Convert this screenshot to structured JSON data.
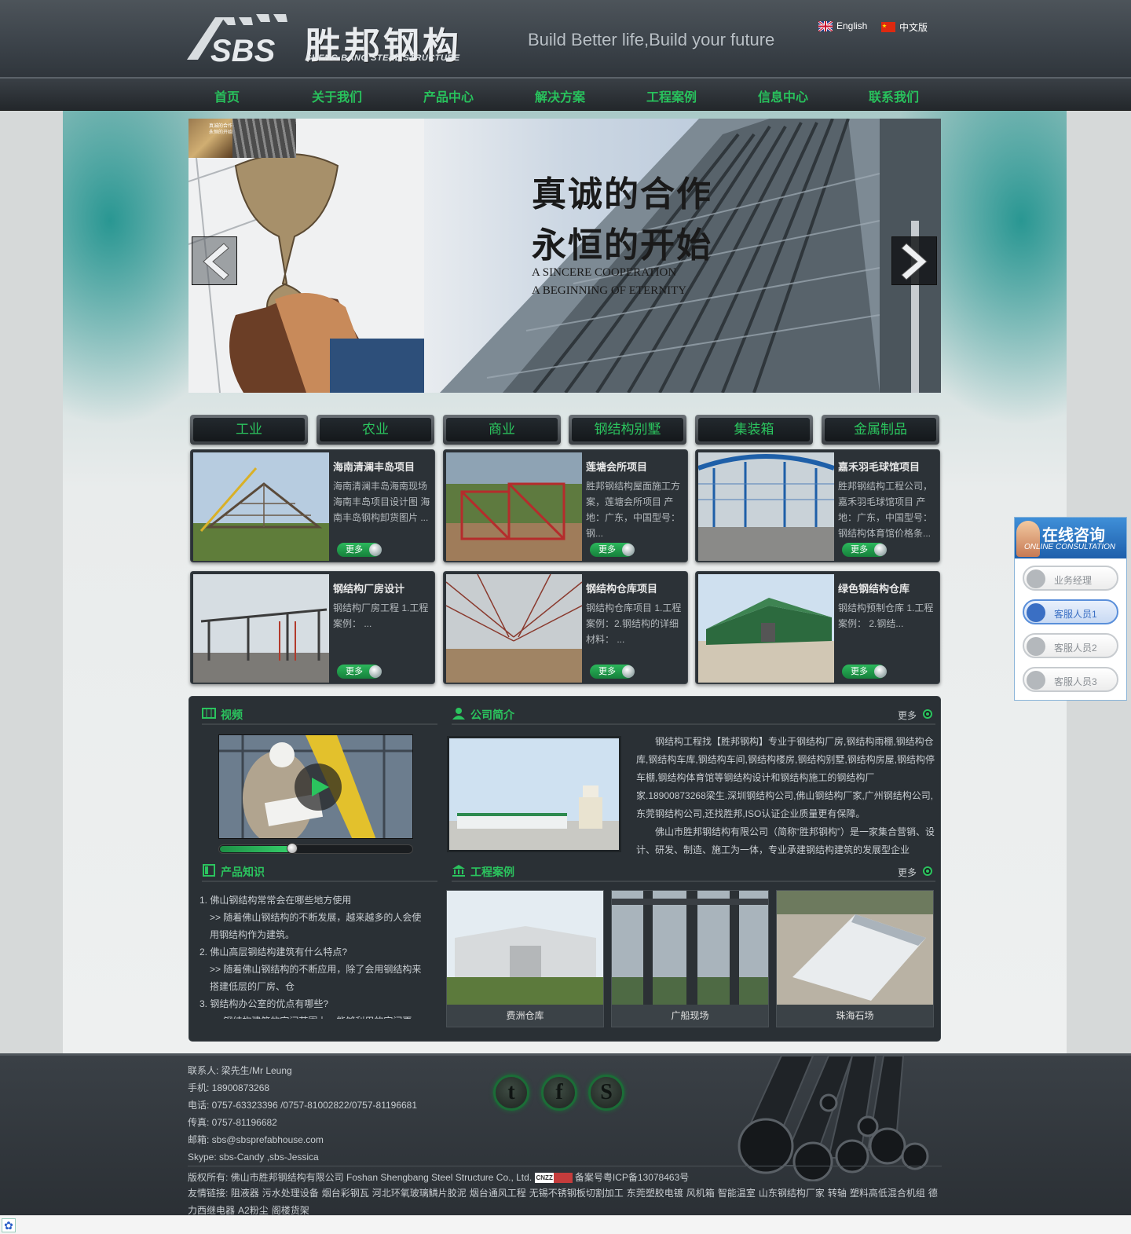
{
  "header": {
    "logo_cn": "胜邦钢构",
    "logo_en": "SHENG BANG STEEL STRUCTURE",
    "logo_mark": "SBS",
    "slogan": "Build Better life,Build your future",
    "lang_en": "English",
    "lang_cn": "中文版"
  },
  "nav": [
    "首页",
    "关于我们",
    "产品中心",
    "解决方案",
    "工程案例",
    "信息中心",
    "联系我们"
  ],
  "banner": {
    "title_line1": "真诚的合作",
    "title_line2": "永恒的开始",
    "en_line1": "A SINCERE COOPERATION",
    "en_line2": "A BEGINNING OF ETERNITY",
    "thumb_text": "真诚的合作 永恒的开始"
  },
  "categories": [
    "工业",
    "农业",
    "商业",
    "钢结构别墅",
    "集装箱",
    "金属制品"
  ],
  "products": [
    {
      "title": "海南清澜丰岛项目",
      "desc": "海南清澜丰岛海南现场 海南丰岛项目设计图 海南丰岛钢构卸货图片 ...",
      "more": "更多"
    },
    {
      "title": "莲塘会所项目",
      "desc": "胜邦钢结构屋面施工方案，莲塘会所项目 产地：广东，中国型号：钢...",
      "more": "更多"
    },
    {
      "title": "嘉禾羽毛球馆项目",
      "desc": "胜邦钢结构工程公司，嘉禾羽毛球馆项目 产地：广东，中国型号：钢结构体育馆价格条...",
      "more": "更多"
    },
    {
      "title": "钢结构厂房设计",
      "desc": "钢结构厂房工程 1.工程案例：  ...",
      "more": "更多"
    },
    {
      "title": "钢结构仓库项目",
      "desc": "钢结构仓库项目 1.工程案例：2.钢结构的详细材料：  ...",
      "more": "更多"
    },
    {
      "title": "绿色钢结构仓库",
      "desc": "钢结构预制仓库 1.工程案例：  2.钢结...",
      "more": "更多"
    }
  ],
  "sections": {
    "video": "视频",
    "about": "公司简介",
    "knowledge": "产品知识",
    "cases": "工程案例",
    "more": "更多"
  },
  "video": {
    "progress": 0.38
  },
  "about_text": [
    "钢结构工程找【胜邦钢构】专业于钢结构厂房,钢结构雨棚,钢结构仓库,钢结构车库,钢结构车间,钢结构楼房,钢结构别墅,钢结构房屋,钢结构停车棚,钢结构体育馆等钢结构设计和钢结构施工的钢结构厂家.18900873268梁生.深圳钢结构公司,佛山钢结构厂家,广州钢结构公司,东莞钢结构公司,还找胜邦,ISO认证企业质量更有保障。",
    "佛山市胜邦钢结构有限公司（简称“胜邦钢构”）是一家集合营销、设计、研发、制造、施工为一体，专业承建钢结构建筑的发展型企业"
  ],
  "knowledge": [
    {
      "q": "1. 佛山钢结构常常会在哪些地方使用",
      "a": ">> 随着佛山钢结构的不断发展，越来越多的人会使用钢结构作为建筑。"
    },
    {
      "q": "2. 佛山高层钢结构建筑有什么特点?",
      "a": ">> 随着佛山钢结构的不断应用，除了会用钢结构来搭建低层的厂房、仓"
    },
    {
      "q": "3. 钢结构办公室的优点有哪些?",
      "a": ">> 钢结构建筑的空间范围上，能够利用的空间更"
    }
  ],
  "cases": [
    "费洲仓库",
    "广船现场",
    "珠海石场"
  ],
  "service": {
    "title": "在线咨询",
    "subtitle": "ONLINE CONSULTATION",
    "items": [
      "业务经理",
      "客服人员1",
      "客服人员2",
      "客服人员3"
    ]
  },
  "footer": {
    "contact": [
      "联系人: 梁先生/Mr Leung",
      "手机: 18900873268",
      "电话: 0757-63323396 /0757-81002822/0757-81196681",
      "传真: 0757-81196682",
      "邮箱: sbs@sbsprefabhouse.com",
      "Skype: sbs-Candy ,sbs-Jessica"
    ],
    "social": [
      "t",
      "f",
      "S"
    ],
    "copyright": "版权所有: 佛山市胜邦钢结构有限公司 Foshan Shengbang Steel Structure Co., Ltd.",
    "cnzz": "CNZZ",
    "icp": "备案号粤ICP备13078463号",
    "links_label": "友情链接:",
    "links": [
      "阻液器",
      "污水处理设备",
      "烟台彩钢瓦",
      "河北环氧玻璃鳞片胶泥",
      "烟台通风工程",
      "无锡不锈钢板切割加工",
      "东莞塑胶电镀",
      "风机箱",
      "智能温室",
      "山东钢结构厂家",
      "转轴",
      "塑料高低混合机组",
      "德力西继电器",
      "A2粉尘",
      "阁楼货架"
    ]
  },
  "colors": {
    "accent_green": "#2bc45e",
    "dark_panel": "#2a3035",
    "header": "#3c434a"
  }
}
